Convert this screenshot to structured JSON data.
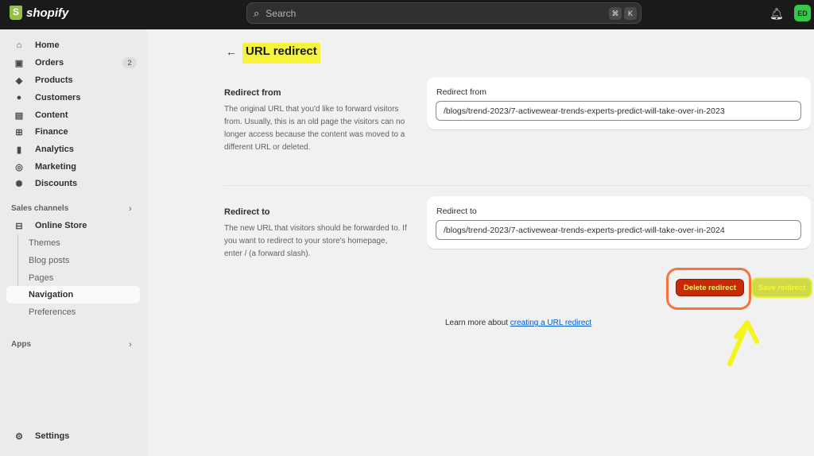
{
  "topbar": {
    "brand": "shopify",
    "search_placeholder": "Search",
    "shortcut_keys": [
      "⌘",
      "K"
    ],
    "avatar_initials": "ED"
  },
  "sidebar": {
    "items": [
      {
        "label": "Home",
        "icon": "home-icon"
      },
      {
        "label": "Orders",
        "icon": "orders-icon",
        "badge": "2"
      },
      {
        "label": "Products",
        "icon": "tag-icon"
      },
      {
        "label": "Customers",
        "icon": "person-icon"
      },
      {
        "label": "Content",
        "icon": "content-icon"
      },
      {
        "label": "Finance",
        "icon": "bank-icon"
      },
      {
        "label": "Analytics",
        "icon": "bar-chart-icon"
      },
      {
        "label": "Marketing",
        "icon": "target-icon"
      },
      {
        "label": "Discounts",
        "icon": "discount-icon"
      }
    ],
    "sales_channels_label": "Sales channels",
    "online_store": "Online Store",
    "sub_items": [
      "Themes",
      "Blog posts",
      "Pages",
      "Navigation",
      "Preferences"
    ],
    "active_sub_item": "Navigation",
    "apps_label": "Apps",
    "settings_label": "Settings"
  },
  "page": {
    "title": "URL redirect",
    "redirect_from": {
      "heading": "Redirect from",
      "description": "The original URL that you'd like to forward visitors from. Usually, this is an old page the visitors can no longer access because the content was moved to a different URL or deleted.",
      "field_label": "Redirect from",
      "value": "/blogs/trend-2023/7-activewear-trends-experts-predict-will-take-over-in-2023"
    },
    "redirect_to": {
      "heading": "Redirect to",
      "description": "The new URL that visitors should be forwarded to. If you want to redirect to your store's homepage, enter / (a forward slash).",
      "field_label": "Redirect to",
      "value": "/blogs/trend-2023/7-activewear-trends-experts-predict-will-take-over-in-2024"
    },
    "delete_button": "Delete redirect",
    "save_button": "Save redirect",
    "learn_more_prefix": "Learn more about",
    "learn_more_link": "creating a URL redirect"
  },
  "colors": {
    "topbar": "#1a1a1a",
    "highlight": "#f6f33a",
    "delete": "#c62a06",
    "annotation_ring": "#f4743c",
    "link": "#005bd3"
  }
}
